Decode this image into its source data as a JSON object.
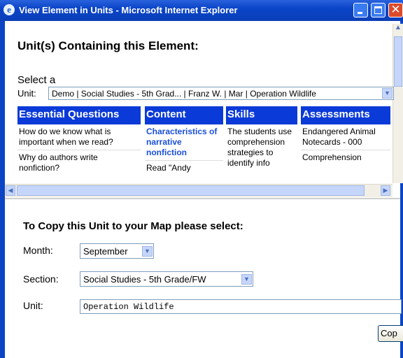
{
  "window": {
    "title": "View Element in Units - Microsoft Internet Explorer"
  },
  "header": {
    "title": "Unit(s) Containing this Element:"
  },
  "select": {
    "prompt": "Select a",
    "label": "Unit:",
    "value": "Demo | Social Studies - 5th Grad... | Franz W. | Mar | Operation Wildlife"
  },
  "columns": [
    {
      "heading": "Essential Questions",
      "cells": [
        "How do we know what is important when we read?",
        "Why do authors write nonfiction?"
      ]
    },
    {
      "heading": "Content",
      "cells": [
        "Characteristics of narrative nonfiction",
        "Read \"Andy"
      ]
    },
    {
      "heading": "Skills",
      "cells": [
        "The students use comprehension strategies to identify info"
      ]
    },
    {
      "heading": "Assessments",
      "cells": [
        "Endangered Animal Notecards - 000",
        "Comprehension"
      ]
    }
  ],
  "copy": {
    "title": "To Copy this Unit to your Map please select:",
    "month_label": "Month:",
    "month_value": "September",
    "section_label": "Section:",
    "section_value": "Social Studies - 5th Grade/FW",
    "unit_label": "Unit:",
    "unit_value": "Operation Wildlife",
    "button": "Cop"
  }
}
